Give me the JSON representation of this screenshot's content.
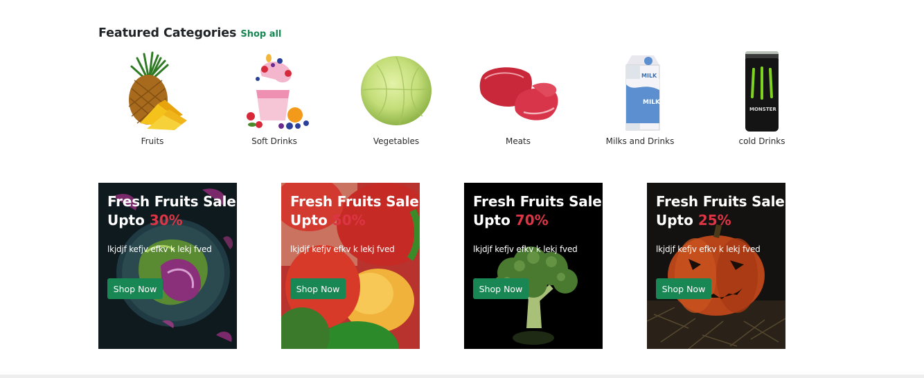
{
  "section": {
    "title": "Featured Categories",
    "shop_all": "Shop all"
  },
  "categories": [
    {
      "label": "Fruits",
      "icon": "pineapple-icon"
    },
    {
      "label": "Soft Drinks",
      "icon": "smoothie-splash-icon"
    },
    {
      "label": "Vegetables",
      "icon": "cabbage-icon"
    },
    {
      "label": "Meats",
      "icon": "meat-icon"
    },
    {
      "label": "Milks and Drinks",
      "icon": "milk-carton-icon"
    },
    {
      "label": "cold Drinks",
      "icon": "energy-can-icon"
    }
  ],
  "can_label": "MONSTER",
  "carton_label": "MILK",
  "promos": [
    {
      "title": "Fresh Fruits Sale",
      "upto": "Upto ",
      "percent": "30%",
      "desc": "lkjdjf kefjv efkv k lekj fved",
      "button": "Shop Now",
      "image": "purple-lettuce-bowl"
    },
    {
      "title": "Fresh Fruits Sale",
      "upto": "Upto ",
      "percent": "50%",
      "desc": "lkjdjf kefjv efkv k lekj fved",
      "button": "Shop Now",
      "image": "bell-peppers"
    },
    {
      "title": "Fresh Fruits Sale",
      "upto": "Upto ",
      "percent": "70%",
      "desc": "lkjdjf kefjv efkv k lekj fved",
      "button": "Shop Now",
      "image": "broccoli"
    },
    {
      "title": "Fresh Fruits Sale",
      "upto": "Upto ",
      "percent": "25%",
      "desc": "lkjdjf kefjv efkv k lekj fved",
      "button": "Shop Now",
      "image": "pumpkin"
    }
  ],
  "colors": {
    "accent_green": "#198754",
    "percent_red": "#dc3545",
    "heading": "#1f2326"
  }
}
